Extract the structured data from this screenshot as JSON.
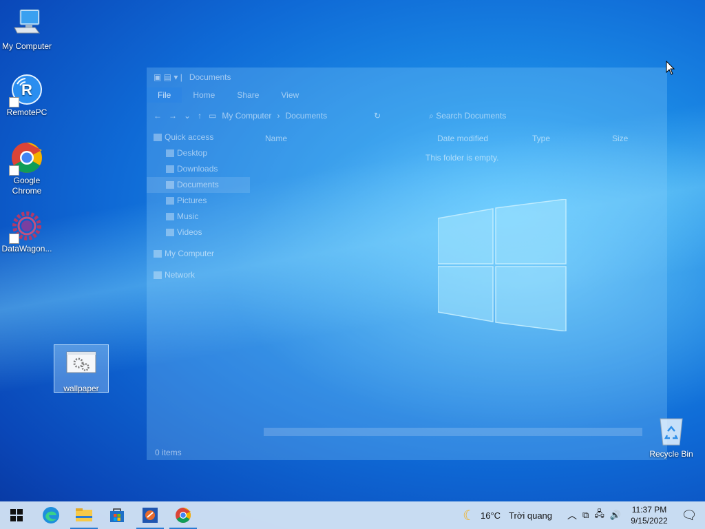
{
  "desktop": {
    "icons": [
      {
        "label": "My Computer"
      },
      {
        "label": "RemotePC"
      },
      {
        "label": "Google Chrome"
      },
      {
        "label": "DataWagon..."
      },
      {
        "label": "wallpaper"
      },
      {
        "label": "Recycle Bin"
      }
    ]
  },
  "explorer": {
    "title": "Documents",
    "tabs": [
      "File",
      "Home",
      "Share",
      "View"
    ],
    "path": [
      "My Computer",
      "Documents"
    ],
    "search_placeholder": "Search Documents",
    "nav": [
      {
        "label": "Quick access"
      },
      {
        "label": "Desktop"
      },
      {
        "label": "Downloads"
      },
      {
        "label": "Documents"
      },
      {
        "label": "Pictures"
      },
      {
        "label": "Music"
      },
      {
        "label": "Videos"
      },
      {
        "label": "My Computer"
      },
      {
        "label": "Network"
      }
    ],
    "columns": [
      "Name",
      "Date modified",
      "Type",
      "Size"
    ],
    "empty_message": "This folder is empty.",
    "status": "0 items"
  },
  "taskbar": {
    "apps": [
      "start",
      "edge",
      "file-explorer",
      "store",
      "remotepc",
      "chrome"
    ],
    "weather": {
      "temp": "16°C",
      "condition": "Trời quang"
    },
    "time": "11:37 PM",
    "date": "9/15/2022"
  },
  "colors": {
    "accent": "#2b7cd3",
    "taskbar": "#d7e6f5"
  }
}
